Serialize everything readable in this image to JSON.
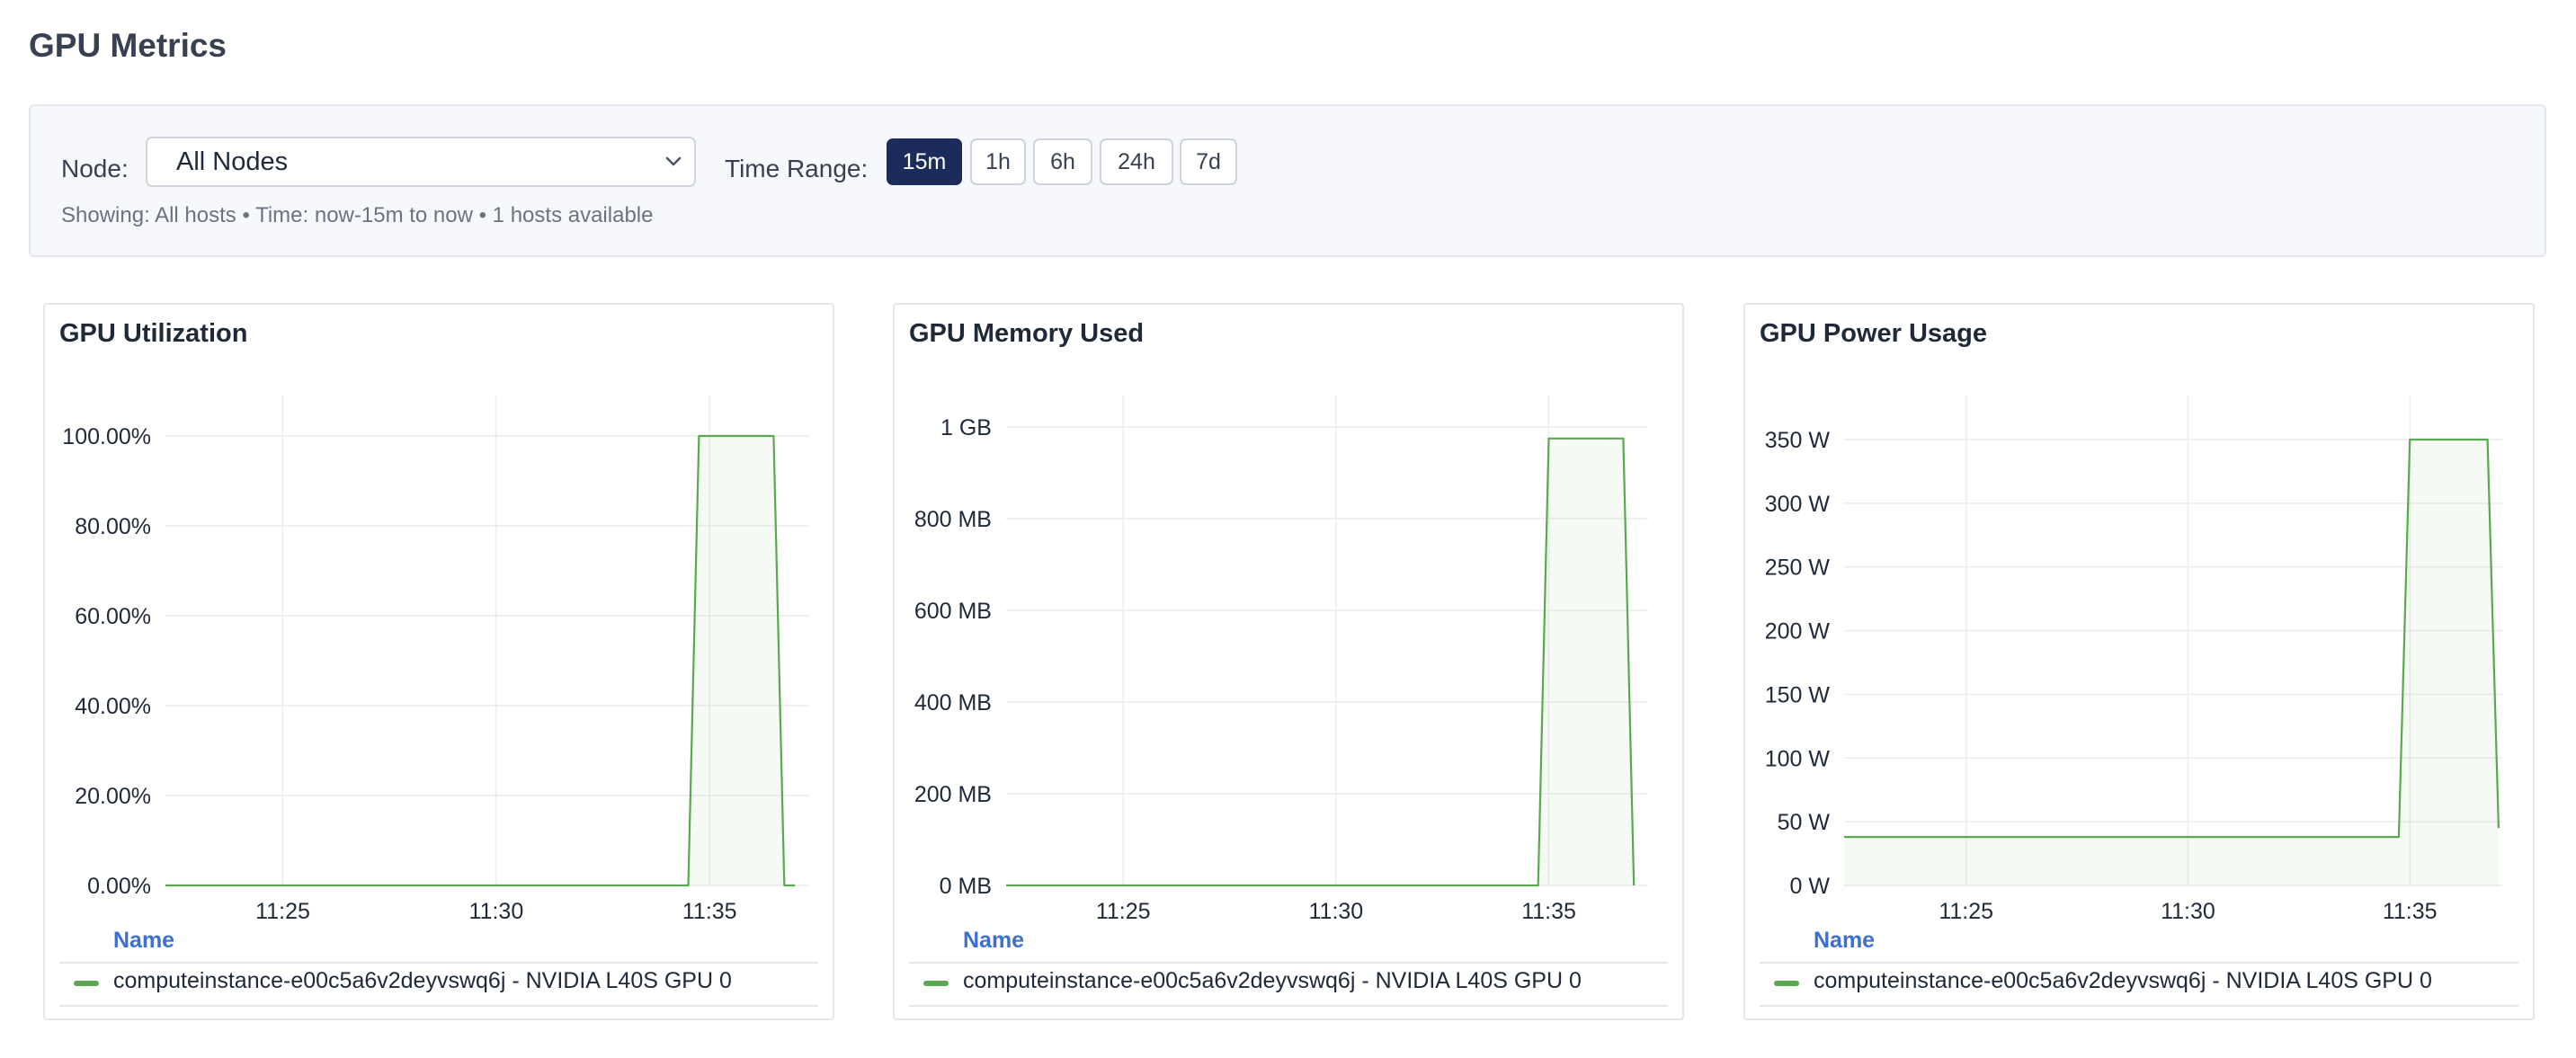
{
  "page": {
    "title": "GPU Metrics"
  },
  "filters": {
    "node_label": "Node:",
    "node_value": "All Nodes",
    "time_range_label": "Time Range:",
    "time_ranges": [
      {
        "label": "15m",
        "active": true
      },
      {
        "label": "1h",
        "active": false
      },
      {
        "label": "6h",
        "active": false
      },
      {
        "label": "24h",
        "active": false
      },
      {
        "label": "7d",
        "active": false
      }
    ],
    "status": "Showing: All hosts • Time: now-15m to now • 1 hosts available"
  },
  "colors": {
    "series": "#5aa84f",
    "active_button": "#1b2c5c",
    "legend_header": "#3b6fd4"
  },
  "legend": {
    "header": "Name",
    "series_name": "computeinstance-e00c5a6v2deyvswq6j - NVIDIA L40S GPU 0"
  },
  "chart_data": [
    {
      "type": "area",
      "title": "GPU Utilization",
      "x_ticks": [
        "11:25",
        "11:30",
        "11:35"
      ],
      "y_ticks": [
        "0.00%",
        "20.00%",
        "40.00%",
        "60.00%",
        "80.00%",
        "100.00%"
      ],
      "ylim": [
        0,
        100
      ],
      "grid": true,
      "legend_placement": "bottom",
      "series": [
        {
          "name": "computeinstance-e00c5a6v2deyvswq6j - NVIDIA L40S GPU 0",
          "x": [
            "11:22:15",
            "11:34:30",
            "11:34:45",
            "11:36:30",
            "11:36:45",
            "11:37:00"
          ],
          "values": [
            0,
            0,
            100,
            100,
            0,
            0
          ]
        }
      ]
    },
    {
      "type": "area",
      "title": "GPU Memory Used",
      "x_ticks": [
        "11:25",
        "11:30",
        "11:35"
      ],
      "y_ticks": [
        "0 MB",
        "200 MB",
        "400 MB",
        "600 MB",
        "800 MB",
        "1 GB"
      ],
      "ylim": [
        0,
        1000
      ],
      "unit": "MB",
      "grid": true,
      "legend_placement": "bottom",
      "series": [
        {
          "name": "computeinstance-e00c5a6v2deyvswq6j - NVIDIA L40S GPU 0",
          "x": [
            "11:22:15",
            "11:34:45",
            "11:35:00",
            "11:36:45",
            "11:37:00"
          ],
          "values": [
            0,
            0,
            975,
            975,
            0
          ]
        }
      ]
    },
    {
      "type": "area",
      "title": "GPU Power Usage",
      "x_ticks": [
        "11:25",
        "11:30",
        "11:35"
      ],
      "y_ticks": [
        "0 W",
        "50 W",
        "100 W",
        "150 W",
        "200 W",
        "250 W",
        "300 W",
        "350 W"
      ],
      "ylim": [
        0,
        375
      ],
      "unit": "W",
      "grid": true,
      "legend_placement": "bottom",
      "series": [
        {
          "name": "computeinstance-e00c5a6v2deyvswq6j - NVIDIA L40S GPU 0",
          "x": [
            "11:22:15",
            "11:34:45",
            "11:35:00",
            "11:36:45",
            "11:37:00"
          ],
          "values": [
            38,
            38,
            350,
            350,
            45
          ]
        }
      ]
    }
  ]
}
